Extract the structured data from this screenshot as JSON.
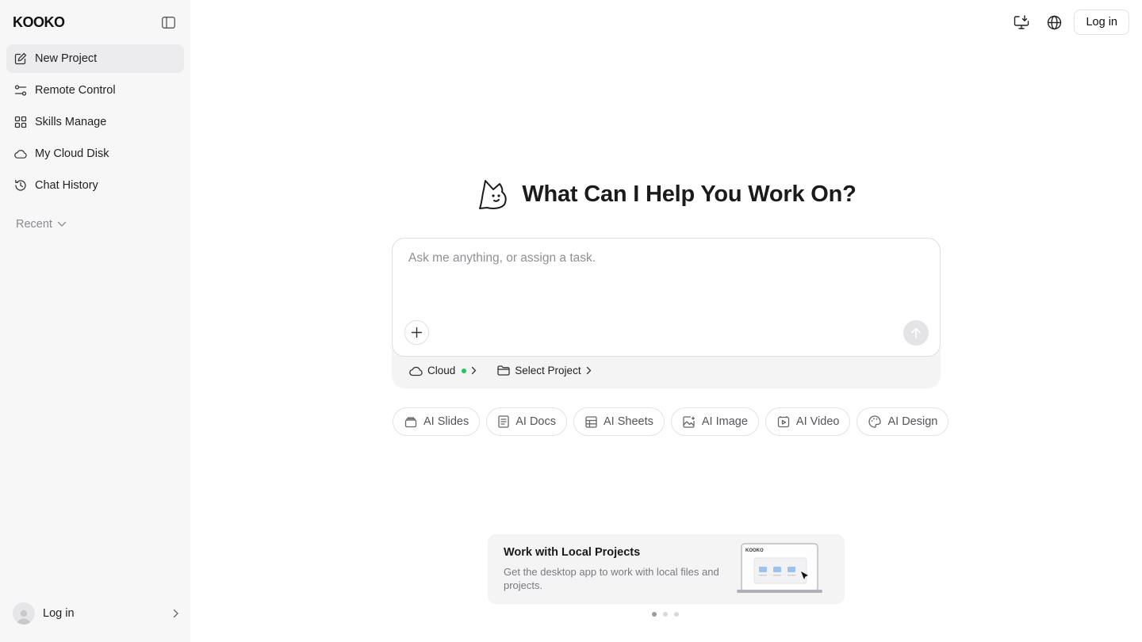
{
  "sidebar": {
    "logo": "KOOKO",
    "items": [
      {
        "label": "New Project",
        "icon": "edit-icon"
      },
      {
        "label": "Remote Control",
        "icon": "remote-control-icon"
      },
      {
        "label": "Skills Manage",
        "icon": "grid-icon"
      },
      {
        "label": "My Cloud Disk",
        "icon": "cloud-icon"
      },
      {
        "label": "Chat History",
        "icon": "history-icon"
      }
    ],
    "recent_label": "Recent",
    "login_label": "Log in"
  },
  "header": {
    "login_label": "Log in"
  },
  "hero": {
    "title": "What Can I Help You Work On?"
  },
  "prompt": {
    "placeholder": "Ask me anything, or assign a task.",
    "value": "",
    "mode_label": "Cloud",
    "mode_status_color": "#22c55e",
    "project_label": "Select Project"
  },
  "chips": [
    {
      "label": "AI Slides",
      "icon": "slides-icon"
    },
    {
      "label": "AI Docs",
      "icon": "docs-icon"
    },
    {
      "label": "AI Sheets",
      "icon": "sheets-icon"
    },
    {
      "label": "AI Image",
      "icon": "image-icon"
    },
    {
      "label": "AI Video",
      "icon": "video-icon"
    },
    {
      "label": "AI Design",
      "icon": "palette-icon"
    }
  ],
  "promo": {
    "title": "Work with Local Projects",
    "description": "Get the desktop app to work with local files and projects.",
    "art_logo": "KOOKO",
    "page_count": 3,
    "active_page": 1
  },
  "colors": {
    "sidebar_bg": "#f7f7f8",
    "active_item_bg": "#ececee",
    "accent_status": "#22c55e"
  }
}
